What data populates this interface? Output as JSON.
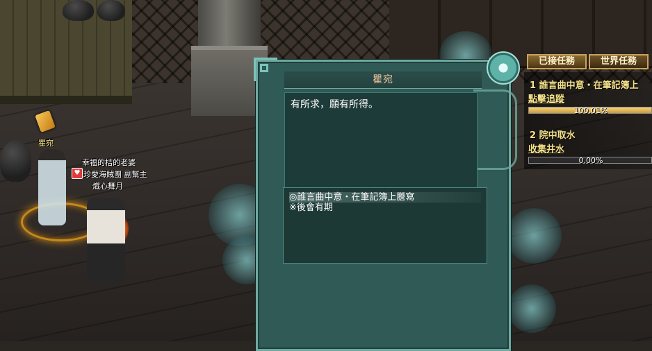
{
  "npc": {
    "quest_marker_icon": "scroll-quest-icon",
    "name": "瞿宛"
  },
  "player": {
    "title": "幸福的桔的老婆",
    "guild_line": "珍愛海賊團 副幫主",
    "name": "熾心舞月",
    "guild_icon": "heart-icon"
  },
  "dialog": {
    "title": "瞿宛",
    "text": "有所求，願有所得。",
    "options": [
      {
        "label": "◎誰言曲中意・在筆記簿上謄寫",
        "highlighted": true
      },
      {
        "label": "※後會有期",
        "highlighted": false
      }
    ]
  },
  "quest_tracker": {
    "tabs": [
      {
        "label": "已接任務",
        "active": true
      },
      {
        "label": "世界任務",
        "active": false
      }
    ],
    "quests": [
      {
        "title": "1 誰言曲中意・在筆記簿上",
        "action": "點擊追蹤",
        "progress_text": "100.01%",
        "progress": 1.0
      },
      {
        "title": "2 院中取水",
        "action": "收集井水",
        "progress_text": "0.00%",
        "progress": 0.0
      }
    ]
  },
  "colors": {
    "dialog_bg": "#2f5a55",
    "dialog_border": "#6fa9a1",
    "title_text": "#f2c8a0",
    "quest_text": "#f5e18a"
  }
}
